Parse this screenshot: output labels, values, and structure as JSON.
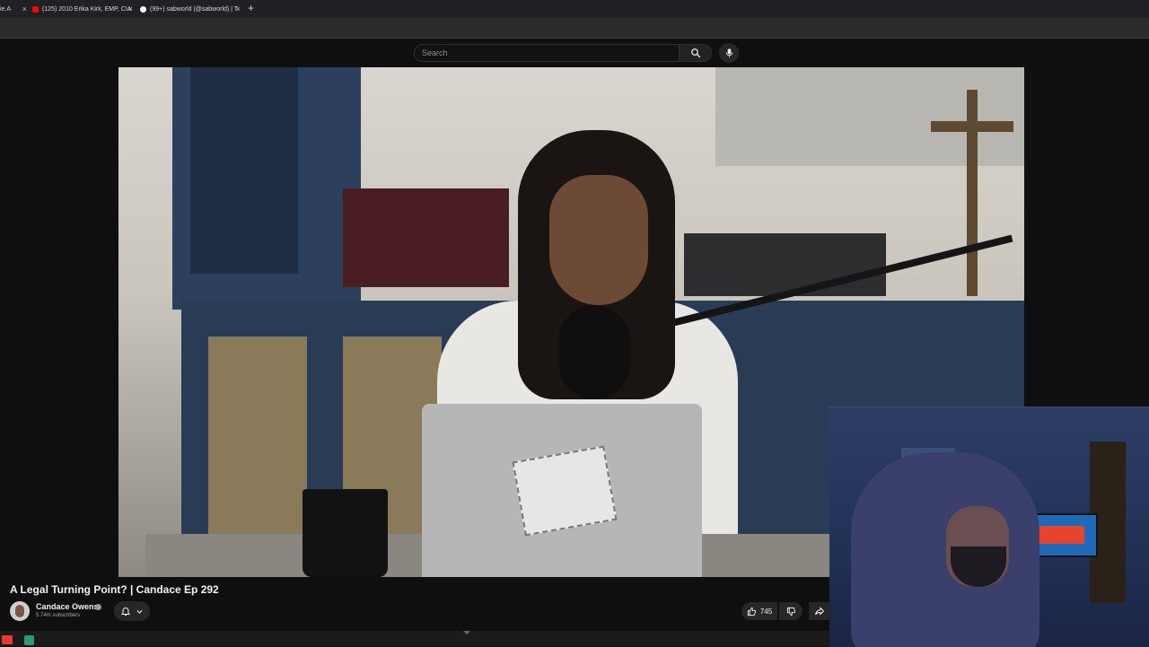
{
  "browser": {
    "tabs": [
      {
        "label": "ie.A",
        "favicon_color": "#8a8a8a"
      },
      {
        "label": "(125) 2010 Erika Kirk, EMP, CIA",
        "favicon_color": "#ff0000"
      },
      {
        "label": "(99+) sabworld (@sabworld) | T",
        "favicon_color": "#ffffff"
      }
    ],
    "close_glyph": "×",
    "new_tab_glyph": "+"
  },
  "header": {
    "search_placeholder": "Search",
    "search_icon": "search-icon",
    "mic_icon": "mic-icon"
  },
  "video": {
    "title": "A Legal Turning Point? | Candace Ep 292"
  },
  "channel": {
    "name": "Candace Owens",
    "subscribers": "5.74m subscribers"
  },
  "actions": {
    "like_count": "745"
  },
  "colors": {
    "background": "#0f0f0f",
    "text": "#f1f1f1",
    "pill": "#272727",
    "youtube_red": "#ff0000"
  }
}
